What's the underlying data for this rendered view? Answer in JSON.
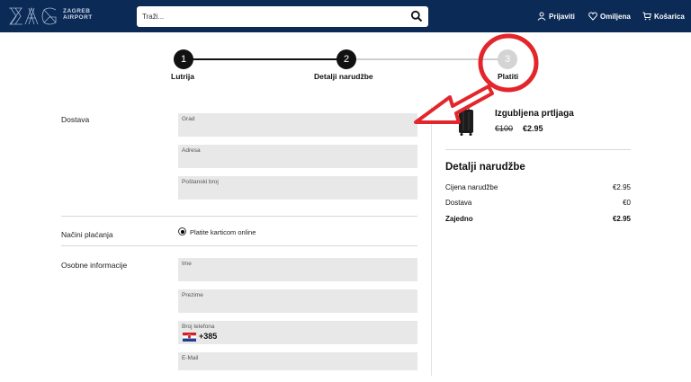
{
  "header": {
    "logo_text_line1": "ZAGREB",
    "logo_text_line2": "AIRPORT",
    "search_placeholder": "Traži...",
    "nav": {
      "login": "Prijaviti",
      "favorites": "Omiljena",
      "cart": "Košarica"
    }
  },
  "steps": [
    {
      "number": "1",
      "label": "Lutrija",
      "state": "done"
    },
    {
      "number": "2",
      "label": "Detalji narudžbe",
      "state": "current"
    },
    {
      "number": "3",
      "label": "Platiti",
      "state": "upcoming"
    }
  ],
  "form": {
    "delivery_label": "Dostava",
    "city_label": "Grad",
    "address_label": "Adresa",
    "postal_label": "Poštanski broj",
    "payment_label": "Načini plaćanja",
    "payment_option": "Platite karticom online",
    "personal_label": "Osobne informacije",
    "name_label": "Ime",
    "surname_label": "Prezime",
    "phone_label": "Broj telefona",
    "phone_code": "+385",
    "email_label": "E-Mail"
  },
  "product": {
    "name": "Izgubljena prtljaga",
    "old_price": "€100",
    "new_price": "€2.95"
  },
  "summary": {
    "title": "Detalji narudžbe",
    "rows": [
      {
        "label": "Cijena narudžbe",
        "value": "€2.95"
      },
      {
        "label": "Dostava",
        "value": "€0"
      },
      {
        "label": "Zajedno",
        "value": "€2.95"
      }
    ]
  },
  "colors": {
    "header_bg": "#0b2a55",
    "annotation_red": "#e3262b",
    "field_bg": "#e8e8e8"
  }
}
